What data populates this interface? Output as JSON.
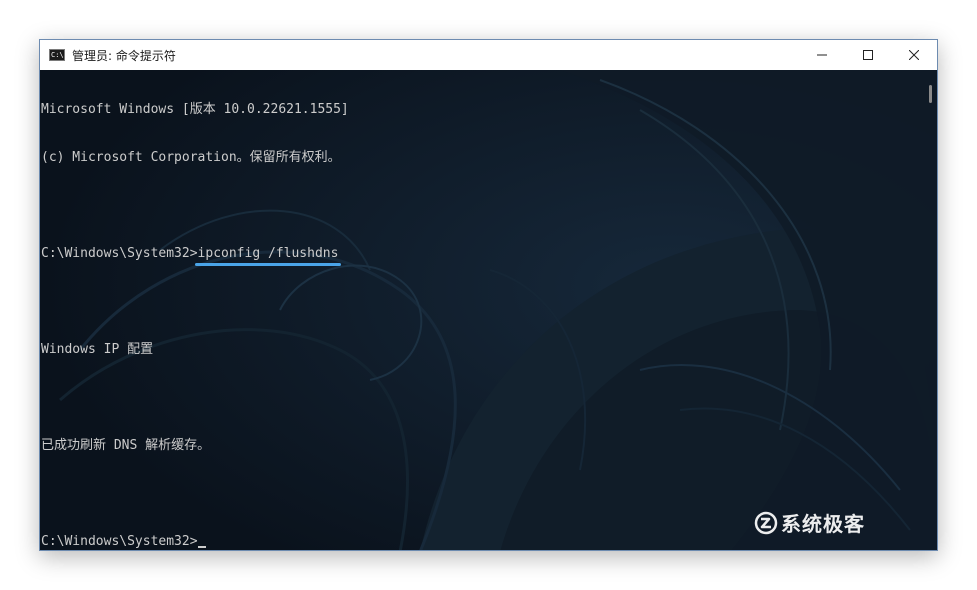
{
  "window": {
    "icon_text": "C:\\",
    "title": "管理员: 命令提示符",
    "controls": {
      "minimize_glyph": "—",
      "maximize_glyph": "☐",
      "close_glyph": "✕"
    }
  },
  "console": {
    "lines": [
      "Microsoft Windows [版本 10.0.22621.1555]",
      "(c) Microsoft Corporation。保留所有权利。",
      "",
      "",
      "Windows IP 配置",
      "",
      "已成功刷新 DNS 解析缓存。",
      ""
    ],
    "command_prompt": "C:\\Windows\\System32>",
    "command": "ipconfig /flushdns",
    "current_prompt": "C:\\Windows\\System32>"
  },
  "watermark": {
    "text": "系统极客"
  },
  "colors": {
    "background": "#0c1520",
    "text": "#cccccc",
    "highlight_underline": "#4aa4e8",
    "titlebar": "#ffffff"
  }
}
